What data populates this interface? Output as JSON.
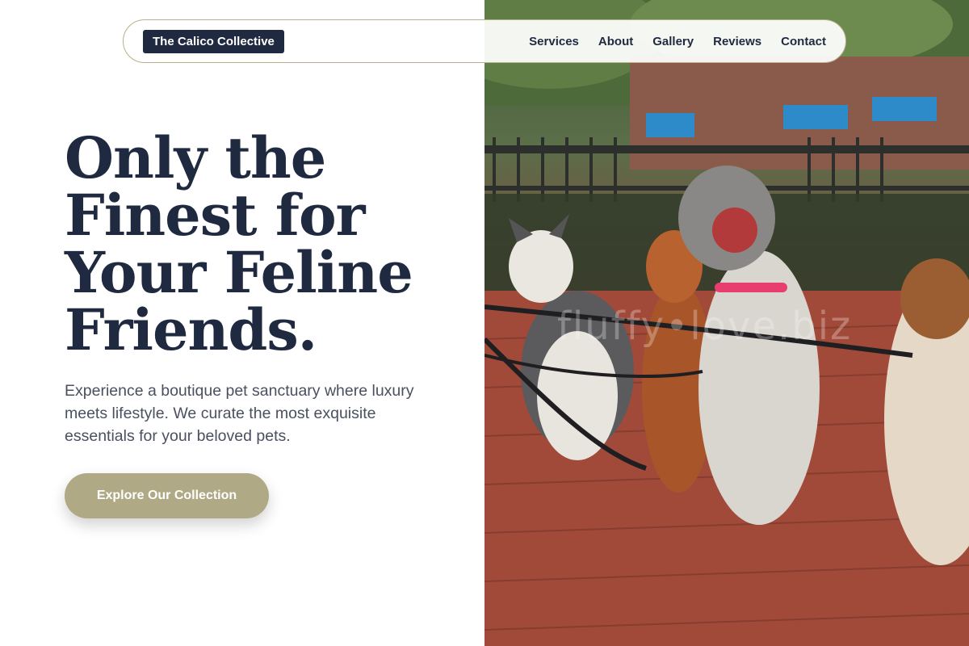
{
  "nav": {
    "brand": "The Calico Collective",
    "links": [
      "Services",
      "About",
      "Gallery",
      "Reviews",
      "Contact"
    ]
  },
  "hero": {
    "title_lines": [
      "Only the",
      "Finest for",
      "Your Feline",
      "Friends."
    ],
    "subtitle": "Experience a boutique pet sanctuary where luxury meets lifestyle. We curate the most exquisite essentials for your beloved pets.",
    "cta_label": "Explore Our Collection"
  },
  "photo": {
    "watermark": "fluffy•love.biz",
    "subject": "dogs-on-leashes-photo"
  },
  "colors": {
    "navy": "#1f2a40",
    "accent": "#b0a985",
    "border": "#b7b08a",
    "body_text": "#4a5060"
  }
}
